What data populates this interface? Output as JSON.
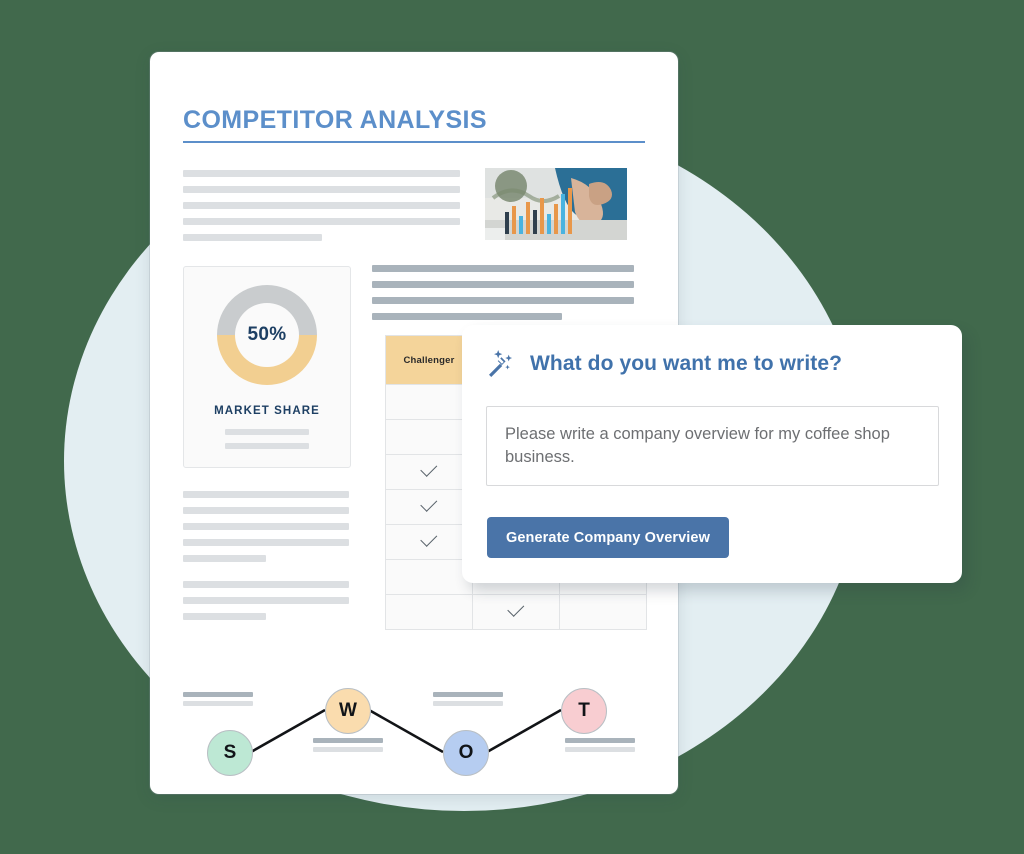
{
  "document": {
    "title": "COMPETITOR ANALYSIS",
    "photo_alt": "bar-chart-photo",
    "market_share_card": {
      "value": "50%",
      "label": "MARKET SHARE",
      "donut": {
        "filled_pct": 50,
        "fill_color": "#f2cf91",
        "track_color": "#c9ccce"
      }
    },
    "comparison_table": {
      "header_label": "Challenger",
      "header_color": "#f4d49a",
      "columns": 3,
      "rows": [
        [
          "",
          "",
          ""
        ],
        [
          "",
          "",
          ""
        ],
        [
          "check",
          "",
          ""
        ],
        [
          "check",
          "",
          ""
        ],
        [
          "check",
          "",
          ""
        ],
        [
          "",
          "check",
          ""
        ],
        [
          "",
          "check",
          ""
        ]
      ]
    },
    "swot": {
      "nodes": [
        {
          "label": "S",
          "color": "#bde8d4"
        },
        {
          "label": "W",
          "color": "#fadcae"
        },
        {
          "label": "O",
          "color": "#b6cdf1"
        },
        {
          "label": "T",
          "color": "#f8cdd1"
        }
      ]
    }
  },
  "dialog": {
    "icon": "magic-wand-icon",
    "title": "What do you want me to write?",
    "prompt_value": "Please write a company overview for my coffee shop business.",
    "prompt_placeholder": "Please write a company overview for my coffee shop business.",
    "generate_label": "Generate Company Overview",
    "accent_color": "#4a74a8"
  },
  "background": {
    "circle_color": "#e3eef2"
  }
}
